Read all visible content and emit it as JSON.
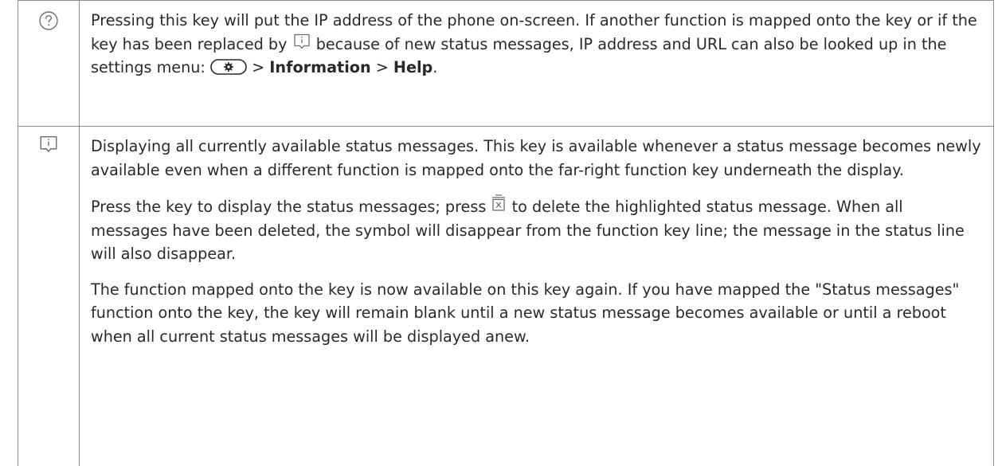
{
  "rows": [
    {
      "icon": "help-question-icon",
      "paragraphs": [
        {
          "lead": "Pressing this key will put the IP address of the phone on-screen.  If another function is mapped onto the key or if the key has been replaced by",
          "inline_icon": "info-message-icon",
          "after_icon": "because of new status messages, IP address and URL can also be looked up in the settings menu:",
          "settings_icon": "settings-key-icon",
          "gt1": " > ",
          "bold1": "Information",
          "gt2": " > ",
          "bold2": "Help",
          "end": "."
        }
      ]
    },
    {
      "icon": "info-message-icon",
      "paragraphs": [
        {
          "text": "Displaying all currently available status messages.  This key is available whenever a status message becomes newly available even when a different function is mapped onto the far-right function key underneath the display."
        },
        {
          "lead": "Press the key to display the status messages;  press",
          "inline_icon": "delete-message-icon",
          "after_icon": "to delete the highlighted status message.  When all messages have been deleted, the symbol will disappear from the function key line; the message in the status line will also disappear."
        },
        {
          "text": "The function mapped onto the key is now available on this key again.  If you have mapped the \"Status messages\" function onto the key, the key will remain blank until a new status message becomes available or until a reboot when all current status messages will be displayed anew."
        }
      ]
    }
  ]
}
